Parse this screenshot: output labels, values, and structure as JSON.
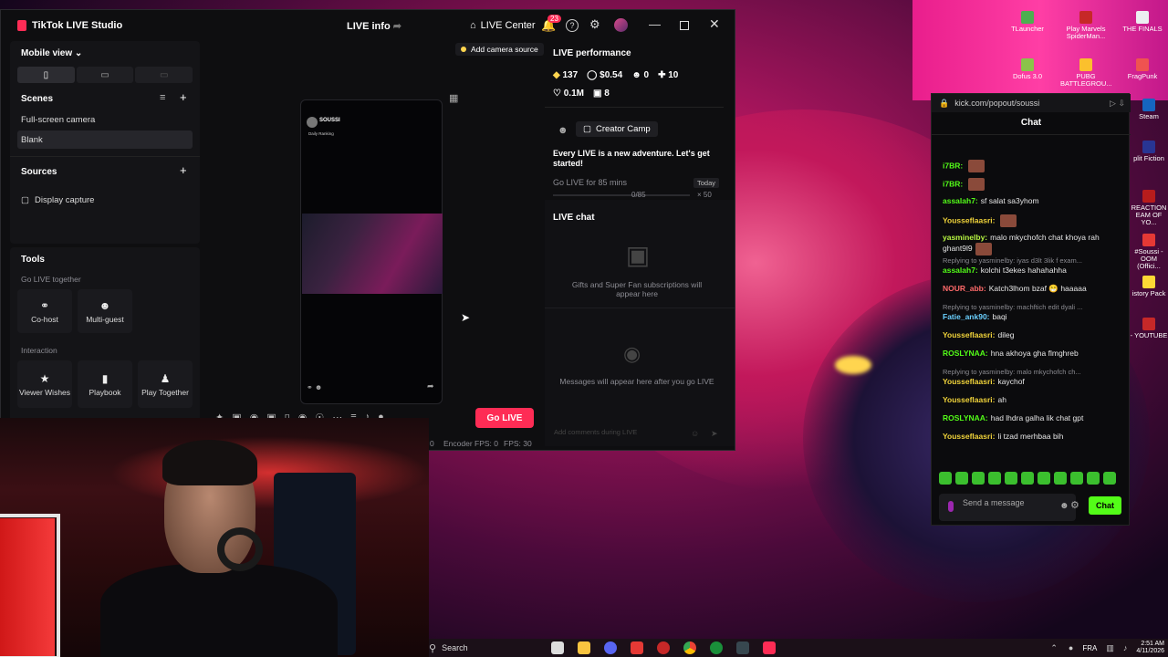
{
  "app": {
    "name": "TikTok LIVE Studio",
    "tab_title": "LIVE info",
    "live_center": "LIVE Center",
    "notif_badge": "23"
  },
  "left": {
    "view_select": "Mobile view",
    "scenes_title": "Scenes",
    "scenes": [
      "Full-screen camera",
      "Blank"
    ],
    "sources_title": "Sources",
    "sources": [
      "Display capture"
    ],
    "tools_title": "Tools",
    "go_live_together": "Go LIVE together",
    "tools_top": [
      {
        "label": "Co-host",
        "icon": "link-icon"
      },
      {
        "label": "Multi-guest",
        "icon": "people-icon"
      }
    ],
    "interaction_title": "Interaction",
    "tools_bottom": [
      {
        "label": "Viewer Wishes",
        "icon": "wish-icon"
      },
      {
        "label": "Playbook",
        "icon": "book-icon"
      },
      {
        "label": "Play Together",
        "icon": "game-icon"
      }
    ]
  },
  "preview": {
    "add_camera": "Add camera source",
    "phone_user": "SOUSSI",
    "phone_sub": "Daily Ranking",
    "go_live": "Go LIVE",
    "encoder": "Encoder FPS: 0",
    "fps": "FPS: 30",
    "leading_zero": "0"
  },
  "performance": {
    "title": "LIVE performance",
    "stats": [
      {
        "icon": "diamond-icon",
        "value": "137"
      },
      {
        "icon": "dollar-icon",
        "value": "$0.54"
      },
      {
        "icon": "person-icon",
        "value": "0"
      },
      {
        "icon": "follower-icon",
        "value": "10"
      },
      {
        "icon": "heart-icon",
        "value": "0.1M"
      },
      {
        "icon": "gift-icon",
        "value": "8"
      }
    ],
    "camp": "Creator Camp",
    "adventure": "Every LIVE is a new adventure. Let's get started!",
    "goal": "Go LIVE for 85 mins",
    "today": "Today",
    "progress": "0/85",
    "reward": "× 50"
  },
  "live_chat": {
    "title": "LIVE chat",
    "gifts_msg": "Gifts and Super Fan subscriptions will appear here",
    "messages_msg": "Messages will appear here after you go LIVE",
    "input_placeholder": "Add comments during LIVE"
  },
  "kick": {
    "url": "kick.com/popout/soussi",
    "title": "Chat",
    "messages": [
      {
        "user": "i7BR:",
        "color": "u-green",
        "text": "",
        "emote": true,
        "reply": ""
      },
      {
        "user": "i7BR:",
        "color": "u-green",
        "text": "",
        "emote": true,
        "reply": ""
      },
      {
        "user": "assalah7:",
        "color": "u-green",
        "text": "sf salat sa3yhom",
        "emote": false,
        "reply": ""
      },
      {
        "user": "Yousseflaasri:",
        "color": "u-yellow",
        "text": "",
        "emote": true,
        "reply": ""
      },
      {
        "user": "yasminelby:",
        "color": "u-lime",
        "text": "malo mkychofch chat khoya rah ghant9l9",
        "emote": true,
        "reply": ""
      },
      {
        "user": "assalah7:",
        "color": "u-green",
        "text": "kolchi t3ekes hahahahha",
        "emote": false,
        "reply": "Replying to yasminelby: iyas d3lt 3lik f exam..."
      },
      {
        "user": "NOUR_abb:",
        "color": "u-red",
        "text": "Katch3lhom bzaf 😁 haaaaa",
        "emote": false,
        "reply": ""
      },
      {
        "user": "Fatie_ank90:",
        "color": "u-blue",
        "text": "baqi",
        "emote": false,
        "reply": "Replying to yasminelby: machftich edit dyali ..."
      },
      {
        "user": "Yousseflaasri:",
        "color": "u-yellow",
        "text": "dileg",
        "emote": false,
        "reply": ""
      },
      {
        "user": "ROSLYNAA:",
        "color": "u-green",
        "text": "hna akhoya gha flmghreb",
        "emote": false,
        "reply": ""
      },
      {
        "user": "Yousseflaasri:",
        "color": "u-yellow",
        "text": "kaychof",
        "emote": false,
        "reply": "Replying to yasminelby: malo mkychofch ch..."
      },
      {
        "user": "Yousseflaasri:",
        "color": "u-yellow",
        "text": "ah",
        "emote": false,
        "reply": ""
      },
      {
        "user": "ROSLYNAA:",
        "color": "u-green",
        "text": "had lhdra galha lik chat gpt",
        "emote": false,
        "reply": ""
      },
      {
        "user": "Yousseflaasri:",
        "color": "u-yellow",
        "text": "li tzad merhbaa bih",
        "emote": false,
        "reply": ""
      }
    ],
    "input_placeholder": "Send a message",
    "chat_button": "Chat"
  },
  "desktop_icons": [
    {
      "label": "TLauncher"
    },
    {
      "label": "Play Marvels SpiderMan..."
    },
    {
      "label": "THE FINALS"
    },
    {
      "label": "Dofus 3.0"
    },
    {
      "label": "PUBG BATTLEGROU..."
    },
    {
      "label": "FragPunk"
    },
    {
      "label": "Steam"
    },
    {
      "label": "plit Fiction"
    },
    {
      "label": "REACTION EAM OF YO..."
    },
    {
      "label": "#Soussi - OOM (Offici..."
    },
    {
      "label": "istory Pack"
    },
    {
      "label": "- YOUTUBE"
    }
  ],
  "taskbar": {
    "search": "Search",
    "lang": "FRA",
    "time": "2:51 AM",
    "date": "4/11/2026"
  },
  "colors": {
    "tiktok_red": "#fe2c55",
    "kick_green": "#53fc18"
  }
}
